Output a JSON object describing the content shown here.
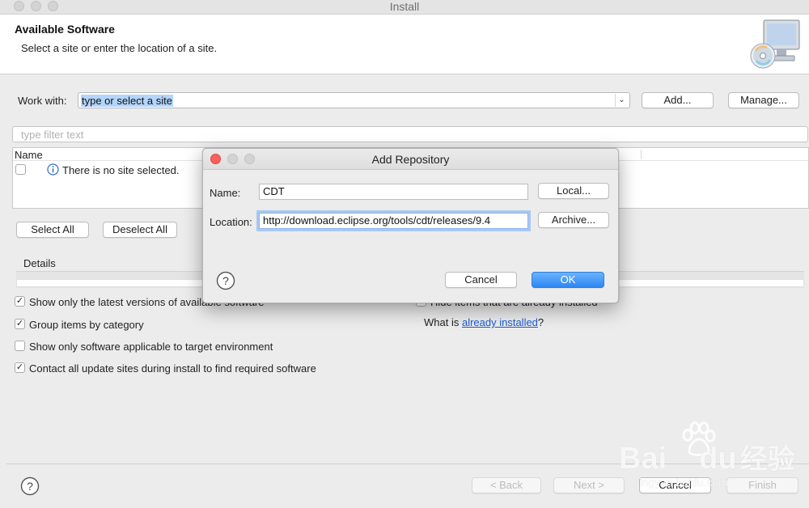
{
  "window": {
    "title": "Install"
  },
  "header": {
    "title": "Available Software",
    "subtitle": "Select a site or enter the location of a site.",
    "icon": "cd-monitor-icon"
  },
  "work_with": {
    "label": "Work with:",
    "value": "type or select a site",
    "add_label": "Add...",
    "manage_label": "Manage..."
  },
  "filter": {
    "placeholder": "type filter text"
  },
  "tree": {
    "column_name": "Name",
    "empty_message": "There is no site selected."
  },
  "selection": {
    "select_all_label": "Select All",
    "deselect_all_label": "Deselect All"
  },
  "details": {
    "label": "Details"
  },
  "options": {
    "latest_versions": {
      "label": "Show only the latest versions of available software",
      "checked": true
    },
    "group_by_category": {
      "label": "Group items by category",
      "checked": true
    },
    "target_env": {
      "label": "Show only software applicable to target environment",
      "checked": false
    },
    "contact_sites": {
      "label": "Contact all update sites during install to find required software",
      "checked": true
    },
    "hide_installed": {
      "label": "Hide items that are already installed",
      "checked": true
    },
    "what_is_prefix": "What is ",
    "already_installed_link": "already installed",
    "what_is_suffix": "?"
  },
  "footer": {
    "back_label": "< Back",
    "next_label": "Next >",
    "cancel_label": "Cancel",
    "finish_label": "Finish"
  },
  "dialog": {
    "title": "Add Repository",
    "name_label": "Name:",
    "name_value": "CDT",
    "location_label": "Location:",
    "location_value": "http://download.eclipse.org/tools/cdt/releases/9.4",
    "local_label": "Local...",
    "archive_label": "Archive...",
    "cancel_label": "Cancel",
    "ok_label": "OK"
  },
  "watermark": {
    "brand": "Bai",
    "brand_tail": "du",
    "cn": "经验",
    "url": "jingyan.baidu.com"
  },
  "colors": {
    "accent": "#2b87f5",
    "link": "#1b5bd4",
    "traffic_close": "#fc605c",
    "selection": "#b3d4fb"
  }
}
